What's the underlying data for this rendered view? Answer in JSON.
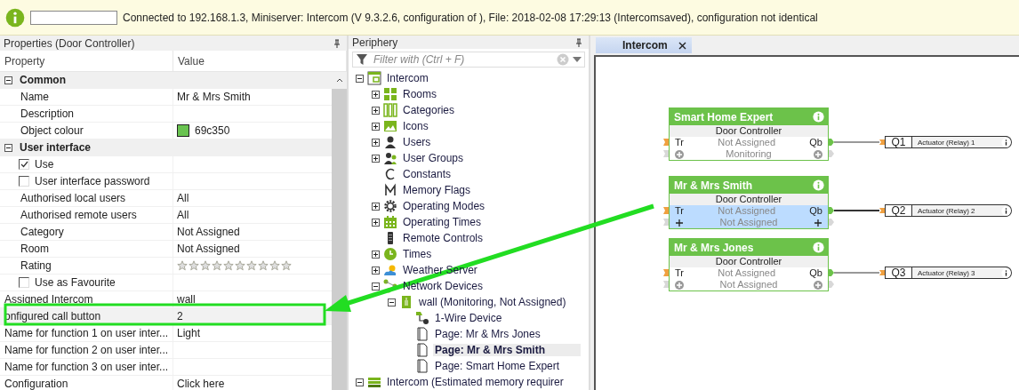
{
  "status_bar": {
    "message": "Connected to 192.168.1.3, Miniserver: Intercom (V 9.3.2.6, configuration of ), File: 2018-02-08 17:29:13 (Intercomsaved), configuration not identical"
  },
  "properties_panel": {
    "title": "Properties (Door Controller)",
    "columns": [
      "Property",
      "Value"
    ],
    "rows": [
      {
        "kind": "group",
        "label": "Common",
        "expanded": true,
        "children": [
          {
            "kind": "text",
            "label": "Name",
            "value": "Mr & Mrs Smith",
            "selected": false
          },
          {
            "kind": "text",
            "label": "Description",
            "selected": false
          },
          {
            "kind": "color",
            "label": "Object colour",
            "value": "69c350",
            "color": "#69c350",
            "selected": false
          }
        ]
      },
      {
        "kind": "group",
        "label": "User interface",
        "expanded": true,
        "children": [
          {
            "kind": "checkbox",
            "label": "Use",
            "checked": true,
            "selected": false
          },
          {
            "kind": "checkbox",
            "label": "User interface password",
            "checked": false,
            "selected": false
          },
          {
            "kind": "text",
            "label": "Authorised local users",
            "value": "All",
            "selected": false
          },
          {
            "kind": "text",
            "label": "Authorised remote users",
            "value": "All",
            "selected": false
          },
          {
            "kind": "text",
            "label": "Category",
            "value": "Not Assigned",
            "selected": false
          },
          {
            "kind": "text",
            "label": "Room",
            "value": "Not Assigned",
            "selected": false
          },
          {
            "kind": "rating",
            "label": "Rating",
            "stars": 0,
            "selected": false
          },
          {
            "kind": "checkbox",
            "label": "Use as Favourite",
            "checked": false,
            "selected": false
          }
        ]
      },
      {
        "kind": "text",
        "label": "Assigned Intercom",
        "value": "wall",
        "selected": false
      },
      {
        "kind": "text",
        "label": "onfigured call button",
        "value": "2",
        "selected": true
      },
      {
        "kind": "text",
        "label": "Name for function 1 on user inter...",
        "value": "Light",
        "selected": false
      },
      {
        "kind": "text",
        "label": "Name for function 2 on user inter...",
        "selected": false
      },
      {
        "kind": "text",
        "label": "Name for function 3 on user inter...",
        "selected": false
      },
      {
        "kind": "text",
        "label": "Configuration",
        "value": "Click here",
        "selected": false
      }
    ]
  },
  "periphery_panel": {
    "title": "Periphery",
    "filter": {
      "placeholder": "Filter with (Ctrl + F)"
    },
    "tree": [
      {
        "label": "Intercom",
        "kind": "controller",
        "expanded": true,
        "selected": false,
        "children": [
          {
            "label": "Rooms",
            "kind": "rooms",
            "expanded": false,
            "selected": false
          },
          {
            "label": "Categories",
            "kind": "categories",
            "expanded": false,
            "selected": false
          },
          {
            "label": "Icons",
            "kind": "icons",
            "expanded": false,
            "selected": false
          },
          {
            "label": "Users",
            "kind": "user",
            "expanded": false,
            "selected": false
          },
          {
            "label": "User Groups",
            "kind": "group",
            "expanded": false,
            "selected": false
          },
          {
            "label": "Constants",
            "kind": "constant",
            "selected": false
          },
          {
            "label": "Memory Flags",
            "kind": "flag",
            "selected": false
          },
          {
            "label": "Operating Modes",
            "kind": "modes",
            "expanded": false,
            "selected": false
          },
          {
            "label": "Operating Times",
            "kind": "schedule",
            "expanded": false,
            "selected": false
          },
          {
            "label": "Remote Controls",
            "kind": "remote",
            "selected": false
          },
          {
            "label": "Times",
            "kind": "clock",
            "expanded": false,
            "selected": false
          },
          {
            "label": "Weather Server",
            "kind": "weather",
            "expanded": false,
            "selected": false
          },
          {
            "label": "Network Devices",
            "kind": "network",
            "expanded": true,
            "selected": false,
            "children": [
              {
                "label": "wall (Monitoring, Not Assigned)",
                "kind": "device",
                "expanded": true,
                "selected": false,
                "children": [
                  {
                    "label": "1-Wire Device",
                    "kind": "sensor",
                    "selected": false
                  },
                  {
                    "label": "Page: Mr & Mrs Jones",
                    "kind": "page",
                    "selected": false
                  },
                  {
                    "label": "Page: Mr & Mrs Smith",
                    "kind": "page",
                    "selected": true
                  },
                  {
                    "label": "Page: Smart Home Expert",
                    "kind": "page",
                    "selected": false
                  }
                ]
              }
            ]
          }
        ]
      },
      {
        "label": "Intercom (Estimated memory requirer",
        "kind": "memory",
        "expanded": true,
        "selected": false
      }
    ]
  },
  "canvas": {
    "tabs": [
      {
        "label": "Intercom",
        "selected": true
      }
    ],
    "blocks": [
      {
        "title": "Smart Home Expert",
        "type": "Door Controller",
        "input": "Tr",
        "output": "Qb",
        "row_1": "Not Assigned",
        "row_2": "Monitoring",
        "selected": false,
        "target": {
          "label": "Q1",
          "name": "Actuator (Relay) 1"
        }
      },
      {
        "title": "Mr & Mrs Smith",
        "type": "Door Controller",
        "input": "Tr",
        "output": "Qb",
        "row_1": "Not Assigned",
        "row_2": "Not Assigned",
        "selected": true,
        "target": {
          "label": "Q2",
          "name": "Actuator (Relay) 2"
        }
      },
      {
        "title": "Mr & Mrs Jones",
        "type": "Door Controller",
        "input": "Tr",
        "output": "Qb",
        "row_1": "Not Assigned",
        "row_2": "Not Assigned",
        "selected": false,
        "target": {
          "label": "Q3",
          "name": "Actuator (Relay) 3"
        }
      }
    ]
  }
}
